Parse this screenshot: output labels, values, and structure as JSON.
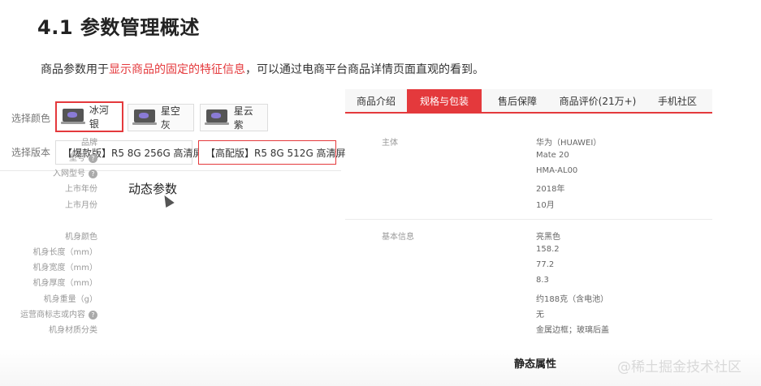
{
  "title": "4.1 参数管理概述",
  "intro": {
    "before": "商品参数用于",
    "highlight": "显示商品的固定的特征信息",
    "after": "，可以通过电商平台商品详情页面直观的看到。"
  },
  "left": {
    "color_label": "选择颜色",
    "colors": [
      "冰河银",
      "星空灰",
      "星云紫"
    ],
    "version_label": "选择版本",
    "versions": [
      "【爆款版】R5 8G 256G 高清屏",
      "【高配版】R5 8G 512G 高清屏"
    ],
    "caption": "动态参数"
  },
  "right": {
    "tabs": [
      "商品介绍",
      "规格与包装",
      "售后保障",
      "商品评价(21万+)",
      "手机社区"
    ],
    "active_tab": "规格与包装",
    "groups": [
      {
        "name": "主体",
        "rows": [
          {
            "key": "品牌",
            "value": "华为（HUAWEI）",
            "help": false
          },
          {
            "key": "型号",
            "value": "Mate 20",
            "help": true
          },
          {
            "key": "入网型号",
            "value": "HMA-AL00",
            "help": true
          },
          {
            "key": "上市年份",
            "value": "2018年",
            "help": false
          },
          {
            "key": "上市月份",
            "value": "10月",
            "help": false
          }
        ]
      },
      {
        "name": "基本信息",
        "rows": [
          {
            "key": "机身颜色",
            "value": "亮黑色",
            "help": false
          },
          {
            "key": "机身长度（mm）",
            "value": "158.2",
            "help": false
          },
          {
            "key": "机身宽度（mm）",
            "value": "77.2",
            "help": false
          },
          {
            "key": "机身厚度（mm）",
            "value": "8.3",
            "help": false
          },
          {
            "key": "机身重量（g）",
            "value": "约188克（含电池）",
            "help": false
          },
          {
            "key": "运营商标志或内容",
            "value": "无",
            "help": true
          },
          {
            "key": "机身材质分类",
            "value": "金属边框；玻璃后盖",
            "help": false
          }
        ]
      }
    ],
    "caption": "静态属性"
  },
  "watermark": "@稀土掘金技术社区",
  "icons": {
    "help": "question-mark-icon",
    "laptop": "laptop-thumbnail-icon",
    "cursor": "mouse-cursor-icon"
  },
  "colors": {
    "accent": "#e4393c"
  }
}
